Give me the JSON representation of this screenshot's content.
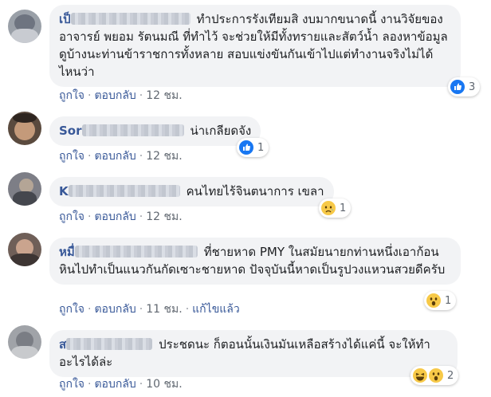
{
  "labels": {
    "like": "ถูกใจ",
    "reply": "ตอบกลับ",
    "edited": "แก้ไขแล้ว",
    "separator": "·"
  },
  "comments": [
    {
      "author_prefix": "เป็",
      "text": "ทำประการรังเทียมสิ งบมากขนาดนี้ งานวิจัยของอาจารย์ พยอม รัตนมณี ที่ทำไว้ จะช่วยให้มีทั้งทรายและสัตว์น้ำ ลองหาข้อมูลดูบ้างนะท่านข้าราชการทั้งหลาย สอบแข่งขันกันเข้าไปแต่ทำงานจริงไม่ได้ไหนว่า",
      "time": "12 ชม.",
      "reaction_count": "3",
      "reactions": [
        "like-icon"
      ]
    },
    {
      "author_prefix": "Sor",
      "text": "น่าเกลียดจัง",
      "time": "12 ชม.",
      "reaction_count": "1",
      "reactions": [
        "like-icon"
      ]
    },
    {
      "author_prefix": "K",
      "text": "คนไทยไร้จินตนาการ เขลา",
      "time": "12 ชม.",
      "reaction_count": "1",
      "reactions": [
        "sad-icon"
      ]
    },
    {
      "author_prefix": "หมื่",
      "text": "ที่ชายหาด PMY ในสมัยนายกท่านหนึ่งเอาก้อนหินไปทำเป็นแนวกันกัดเซาะชายหาด ปัจจุบันนี้หาดเป็นรูปวงแหวนสวยดีครับ",
      "time": "11 ชม.",
      "edited": true,
      "reaction_count": "1",
      "reactions": [
        "wow-icon"
      ]
    },
    {
      "author_prefix": "ส",
      "text": "ประชดนะ ก็ตอนนั้นเงินมันเหลือสร้างได้แค่นี้ จะให้ทำอะไรได้ล่ะ",
      "time": "10 ชม.",
      "reaction_count": "2",
      "reactions": [
        "haha-icon",
        "wow-icon"
      ]
    }
  ],
  "colors": {
    "bubble": "#f2f3f5",
    "author": "#385898",
    "meta": "#606770",
    "like_blue": "#1877f2",
    "emoji_yellow": "#f7c948"
  }
}
